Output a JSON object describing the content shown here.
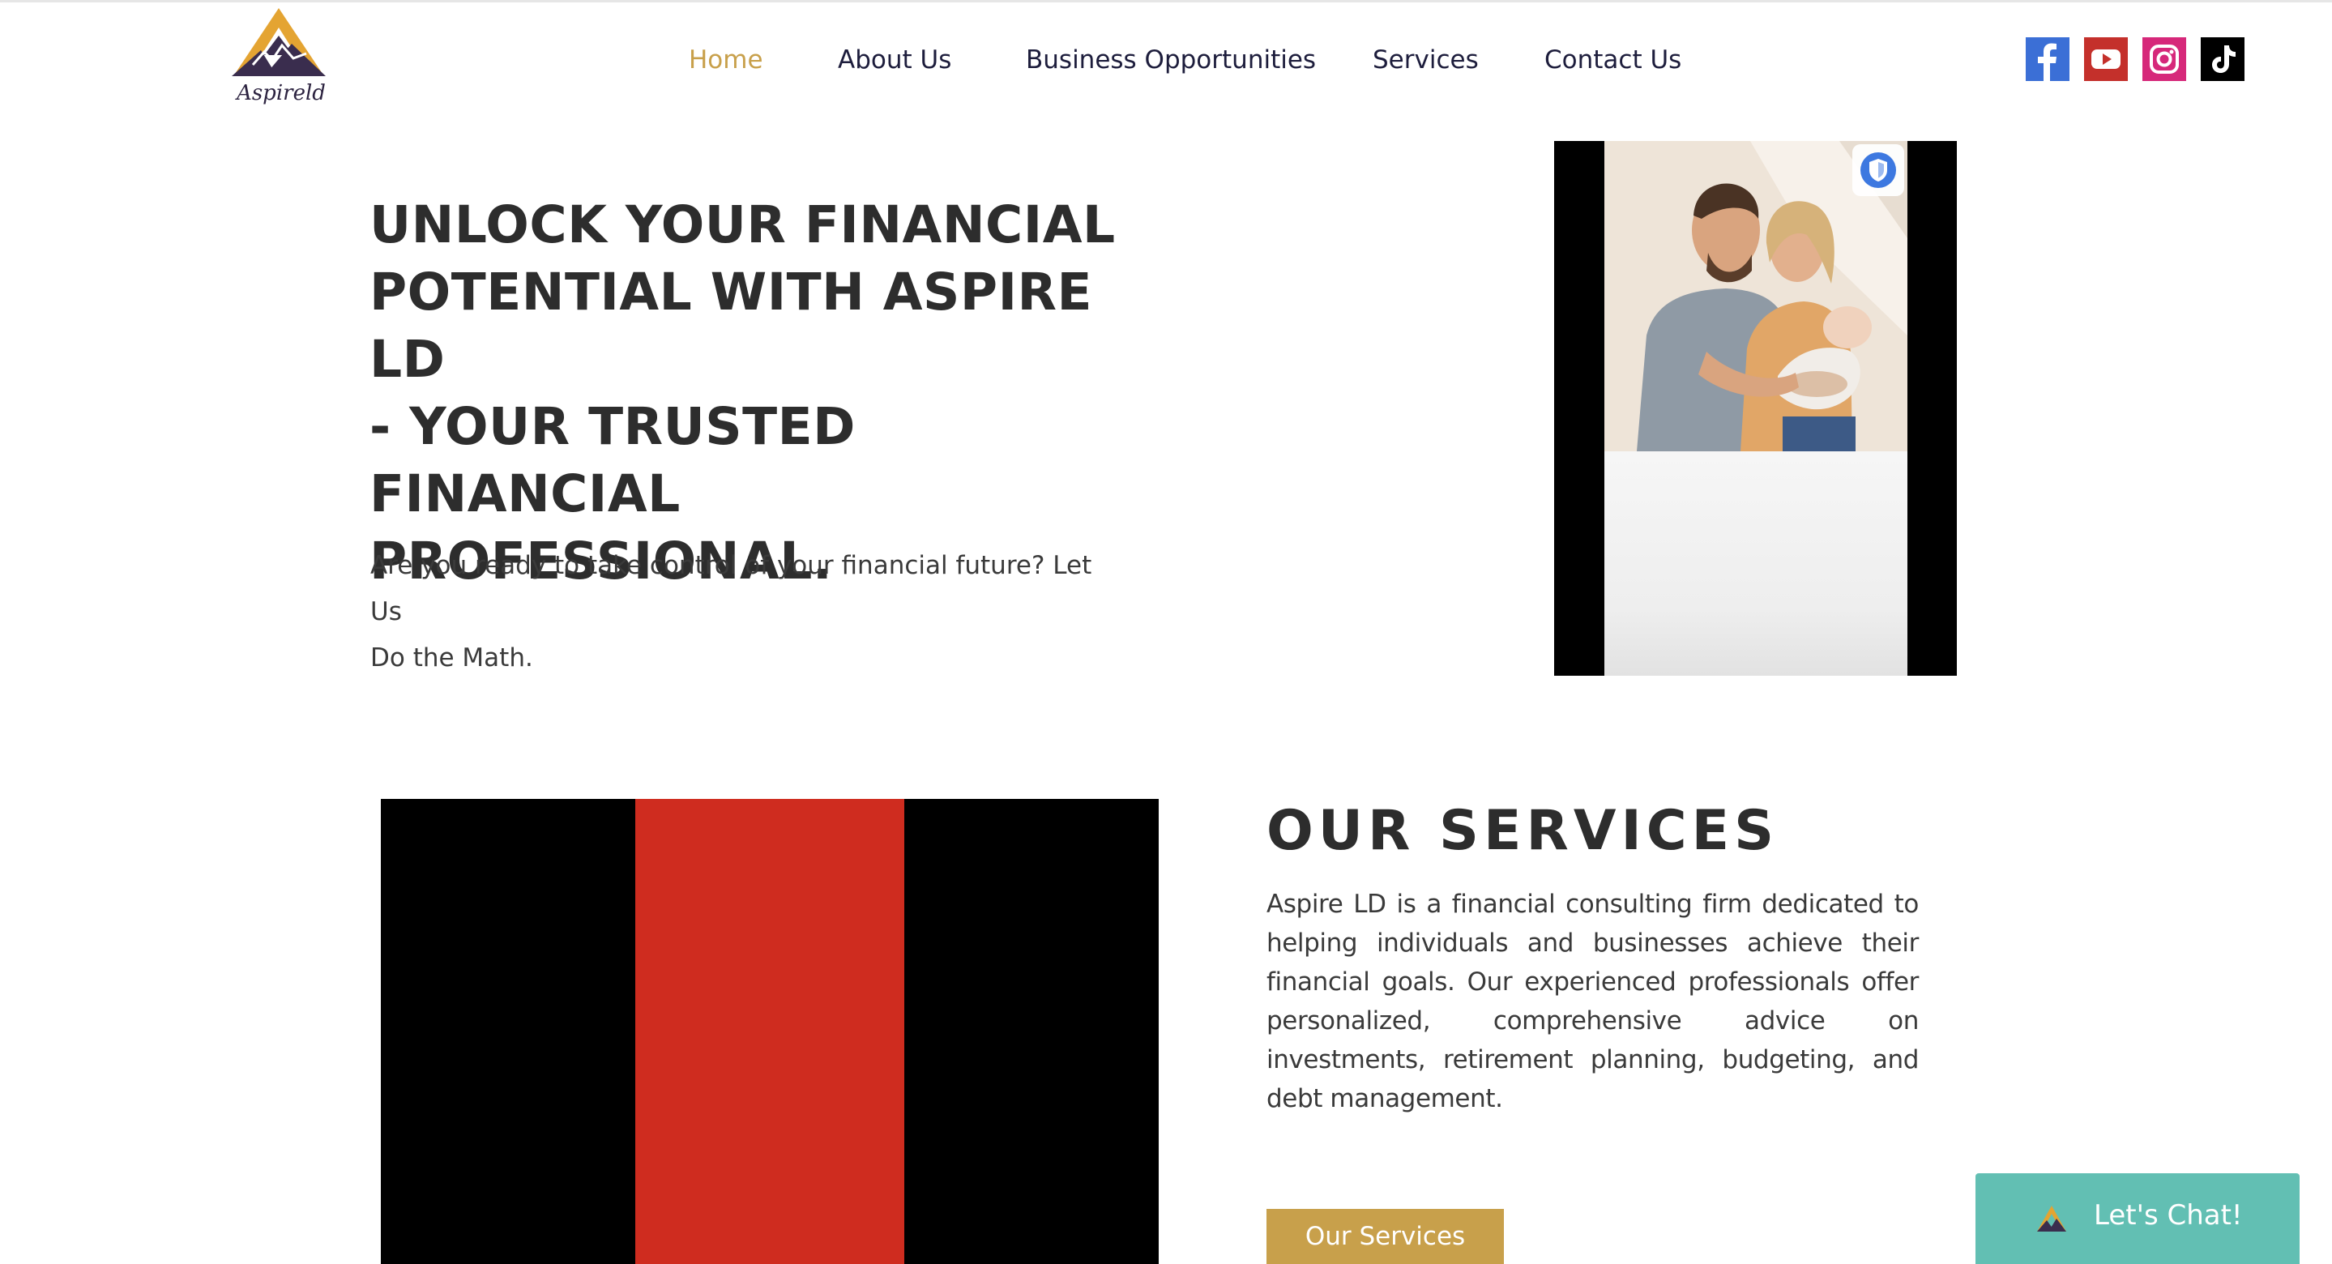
{
  "brand": {
    "logo_text": "Aspireld"
  },
  "nav": {
    "items": [
      "Home",
      "About Us",
      "Business Opportunities",
      "Services",
      "Contact Us"
    ],
    "active": "Home"
  },
  "social": [
    "facebook-icon",
    "youtube-icon",
    "instagram-icon",
    "tiktok-icon"
  ],
  "hero": {
    "title_lines": [
      "UNLOCK YOUR FINANCIAL",
      "POTENTIAL WITH ASPIRE LD",
      "- YOUR TRUSTED FINANCIAL",
      "PROFESSIONAL."
    ],
    "subtitle_lines": [
      "Are you ready to take control of your financial future? Let Us",
      "Do the Math."
    ]
  },
  "services": {
    "heading": "OUR SERVICES",
    "body": "Aspire LD is a financial consulting firm dedicated to helping individuals and businesses achieve their financial goals. Our experienced professionals offer personalized, comprehensive advice on investments, retirement planning, budgeting, and debt management.",
    "button_label": "Our Services"
  },
  "chat": {
    "label": "Let's Chat!"
  },
  "colors": {
    "accent_gold": "#c8a04b",
    "nav_text": "#1d1d3c",
    "heading_text": "#2d2d2d",
    "chat_teal": "#62bfb3",
    "media_red": "#cf2c1f"
  }
}
